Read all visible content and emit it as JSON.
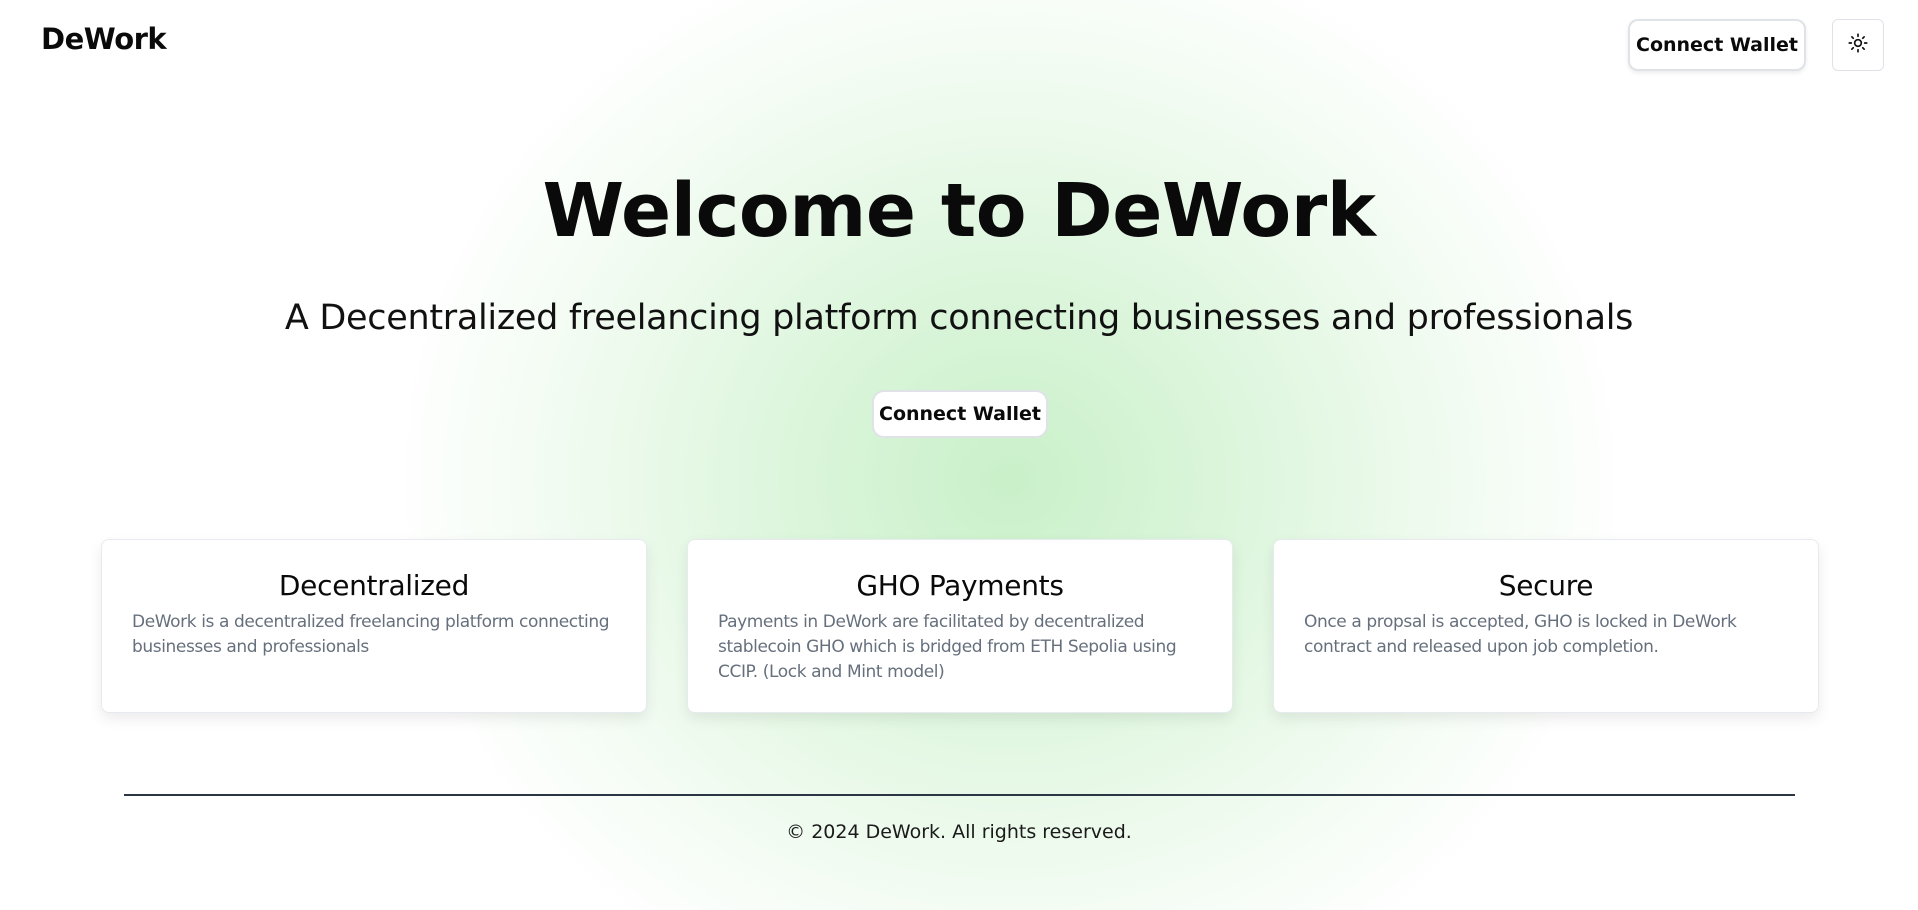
{
  "header": {
    "logo": "DeWork",
    "connect_wallet_label": "Connect Wallet",
    "theme_toggle_icon": "sun-icon"
  },
  "hero": {
    "title": "Welcome to DeWork",
    "subtitle": "A Decentralized freelancing platform connecting businesses and professionals",
    "connect_wallet_label": "Connect Wallet"
  },
  "features": [
    {
      "title": "Decentralized",
      "description": "DeWork is a decentralized freelancing platform connecting businesses and professionals"
    },
    {
      "title": "GHO Payments",
      "description": "Payments in DeWork are facilitated by decentralized stablecoin GHO which is bridged from ETH Sepolia using CCIP. (Lock and Mint model)"
    },
    {
      "title": "Secure",
      "description": "Once a propsal is accepted, GHO is locked in DeWork contract and released upon job completion."
    }
  ],
  "footer": {
    "copyright": "© 2024 DeWork. All rights reserved."
  },
  "colors": {
    "accent_glow": "#c9f0c9",
    "text": "#0a0a0a",
    "muted_text": "#66707d",
    "divider": "#2b3644"
  }
}
